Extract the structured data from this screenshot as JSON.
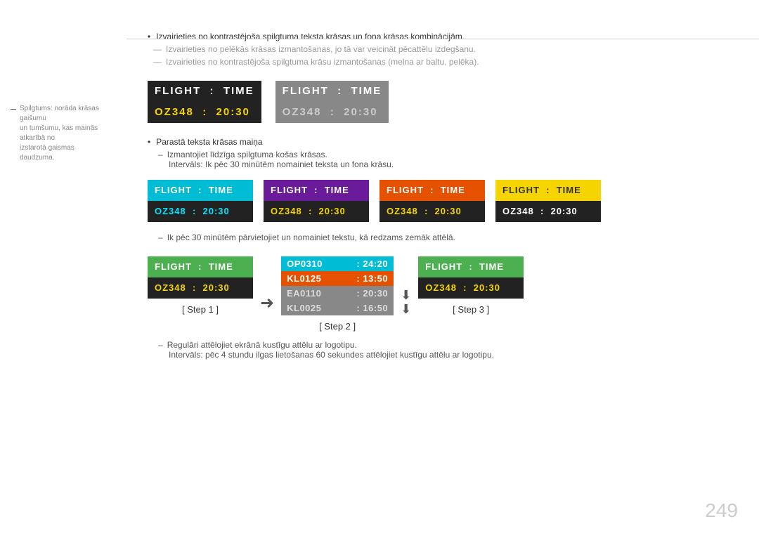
{
  "sidebar": {
    "note_line1": "Spilgtums: norāda krāsas gaišumu",
    "note_line2": "un tumšumu, kas mainās atkarībā no",
    "note_line3": "izstarotā gaismas daudzuma."
  },
  "bullets": {
    "dot1": "Izvairieties no kontrastējoša spilgtuma teksta krāsas un fona krāsas kombinācijām.",
    "dash1": "Izvairieties no pelēkās krāsas izmantošanas, jo tā var veicināt pēcattēlu izdegšanu.",
    "dash2": "Izvairieties no kontrastējoša spilgtuma krāsu izmantošanas (melna ar baltu, pelēka)."
  },
  "display1": {
    "header_line1": "FLIGHT",
    "header_colon": ":",
    "header_line2": "TIME",
    "body_code": "OZ348",
    "body_colon": ":",
    "body_time": "20:30",
    "style": "dark"
  },
  "display2": {
    "header_line1": "FLIGHT",
    "header_colon": ":",
    "header_line2": "TIME",
    "body_code": "OZ348",
    "body_colon": ":",
    "body_time": "20:30",
    "style": "gray"
  },
  "section2": {
    "bullet_dot": "Parastā teksta krāsas maiņa",
    "dash1": "Izmantojiet līdzīga spilgtuma košas krāsas.",
    "dash2": "Intervāls: Ik pēc 30 minūtēm nomainiet teksta un fona krāsu."
  },
  "colored_displays": [
    {
      "style": "cyan",
      "header": "FLIGHT  :  TIME",
      "body_code": "OZ348",
      "body_colon": ":",
      "body_time": "20:30"
    },
    {
      "style": "purple",
      "header": "FLIGHT  :  TIME",
      "body_code": "OZ348",
      "body_colon": ":",
      "body_time": "20:30"
    },
    {
      "style": "orange",
      "header": "FLIGHT  :  TIME",
      "body_code": "OZ348",
      "body_colon": ":",
      "body_time": "20:30"
    },
    {
      "style": "yellow",
      "header": "FLIGHT  :  TIME",
      "body_code": "OZ348",
      "body_colon": ":",
      "body_time": "20:30"
    }
  ],
  "section3": {
    "dash": "Ik pēc 30 minūtēm pārvietojiet un nomainiet tekstu, kā redzams zemāk attēlā."
  },
  "steps": {
    "step1_label": "[ Step 1 ]",
    "step2_label": "[ Step 2 ]",
    "step3_label": "[ Step 3 ]",
    "step1_header": "FLIGHT  :  TIME",
    "step1_code": "OZ348",
    "step1_colon": ":",
    "step1_time": "20:30",
    "step3_header": "FLIGHT  :  TIME",
    "step3_code": "OZ348",
    "step3_colon": ":",
    "step3_time": "20:30",
    "step2_rows": [
      {
        "code": "OP0310",
        "colon": ":",
        "time": "24:20",
        "style": "row1"
      },
      {
        "code": "KL0125",
        "colon": ":",
        "time": "13:50",
        "style": "row2"
      },
      {
        "code": "EA0110",
        "colon": ":",
        "time": "20:30",
        "style": "row3"
      },
      {
        "code": "KL0025",
        "colon": ":",
        "time": "16:50",
        "style": "row4"
      }
    ]
  },
  "bottom_notes": {
    "dash1": "Regulāri attēlojiet ekrānā kustīgu attēlu ar logotipu.",
    "dash2": "Intervāls: pēc 4 stundu ilgas lietošanas 60 sekundes attēlojiet kustīgu attēlu ar logotipu."
  },
  "page_number": "249"
}
